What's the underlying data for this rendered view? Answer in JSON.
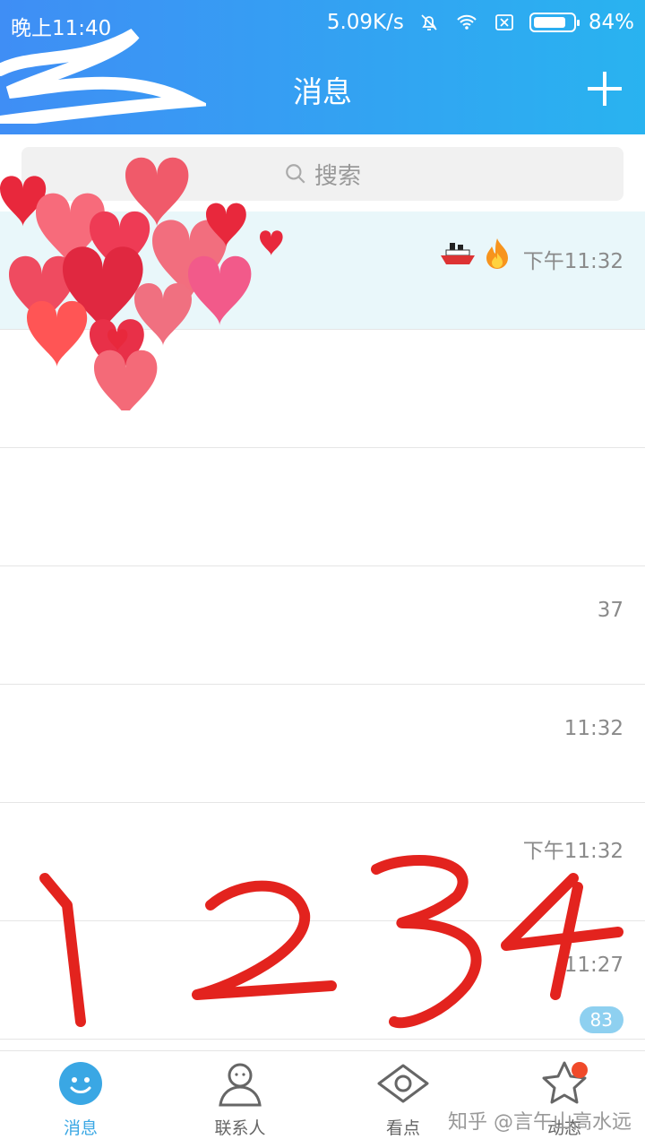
{
  "status_bar": {
    "time": "晚上11:40",
    "network_speed": "5.09K/s",
    "battery_percent": "84%",
    "battery_level": 0.84,
    "icons": [
      "bell-off-icon",
      "wifi-icon",
      "sim-off-icon",
      "battery-icon"
    ]
  },
  "header": {
    "title": "消息",
    "add_icon": "plus-icon"
  },
  "search": {
    "placeholder": "搜索",
    "icon": "search-icon"
  },
  "conversations": [
    {
      "time": "下午11:32",
      "emojis": [
        "ship-emoji",
        "fire-emoji"
      ]
    },
    {
      "time": ""
    },
    {
      "time": ""
    },
    {
      "time": "37"
    },
    {
      "time": "11:32"
    },
    {
      "time": "下午11:32"
    },
    {
      "time": "11:27",
      "badge": "83"
    }
  ],
  "annotation": {
    "text": "1 2 3 4",
    "color": "#e3231e"
  },
  "tabbar": {
    "tabs": [
      {
        "label": "消息",
        "icon": "chat-smile-icon",
        "active": true
      },
      {
        "label": "联系人",
        "icon": "contact-icon",
        "active": false
      },
      {
        "label": "看点",
        "icon": "eye-icon",
        "active": false
      },
      {
        "label": "动态",
        "icon": "star-icon",
        "active": false,
        "dot": true
      }
    ]
  },
  "watermark": "知乎 @言午山高水远",
  "colors": {
    "header_start": "#3f8ef5",
    "header_end": "#29b3f0",
    "active_tab": "#3aa7e4",
    "badge": "#8ed0f0",
    "dot": "#f04a2a"
  }
}
